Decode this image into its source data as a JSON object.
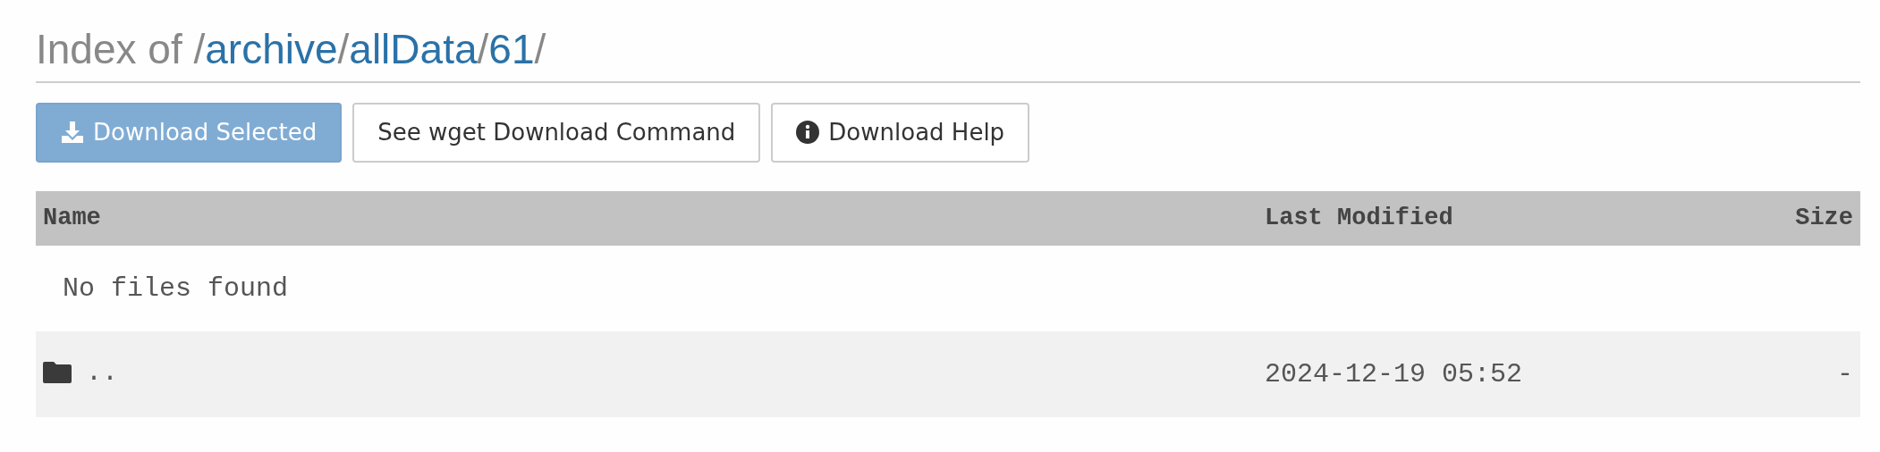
{
  "heading": [
    {
      "text": "Index of /",
      "kind": "plain"
    },
    {
      "text": "archive",
      "kind": "link"
    },
    {
      "text": "/",
      "kind": "plain"
    },
    {
      "text": "allData",
      "kind": "link"
    },
    {
      "text": "/",
      "kind": "plain"
    },
    {
      "text": "61",
      "kind": "link"
    },
    {
      "text": "/",
      "kind": "plain"
    }
  ],
  "buttons": [
    {
      "label": "Download Selected",
      "kind": "download"
    },
    {
      "label": "See wget Download Command",
      "kind": "plain"
    },
    {
      "label": "Download Help",
      "kind": "help"
    }
  ],
  "table": {
    "columns": [
      "Name",
      "Last Modified",
      "Size"
    ],
    "empty_message": "No files found",
    "rows": [
      {
        "kind": "folder",
        "name": "..",
        "modified": "2024-12-19 05:52",
        "size": "-"
      }
    ]
  }
}
